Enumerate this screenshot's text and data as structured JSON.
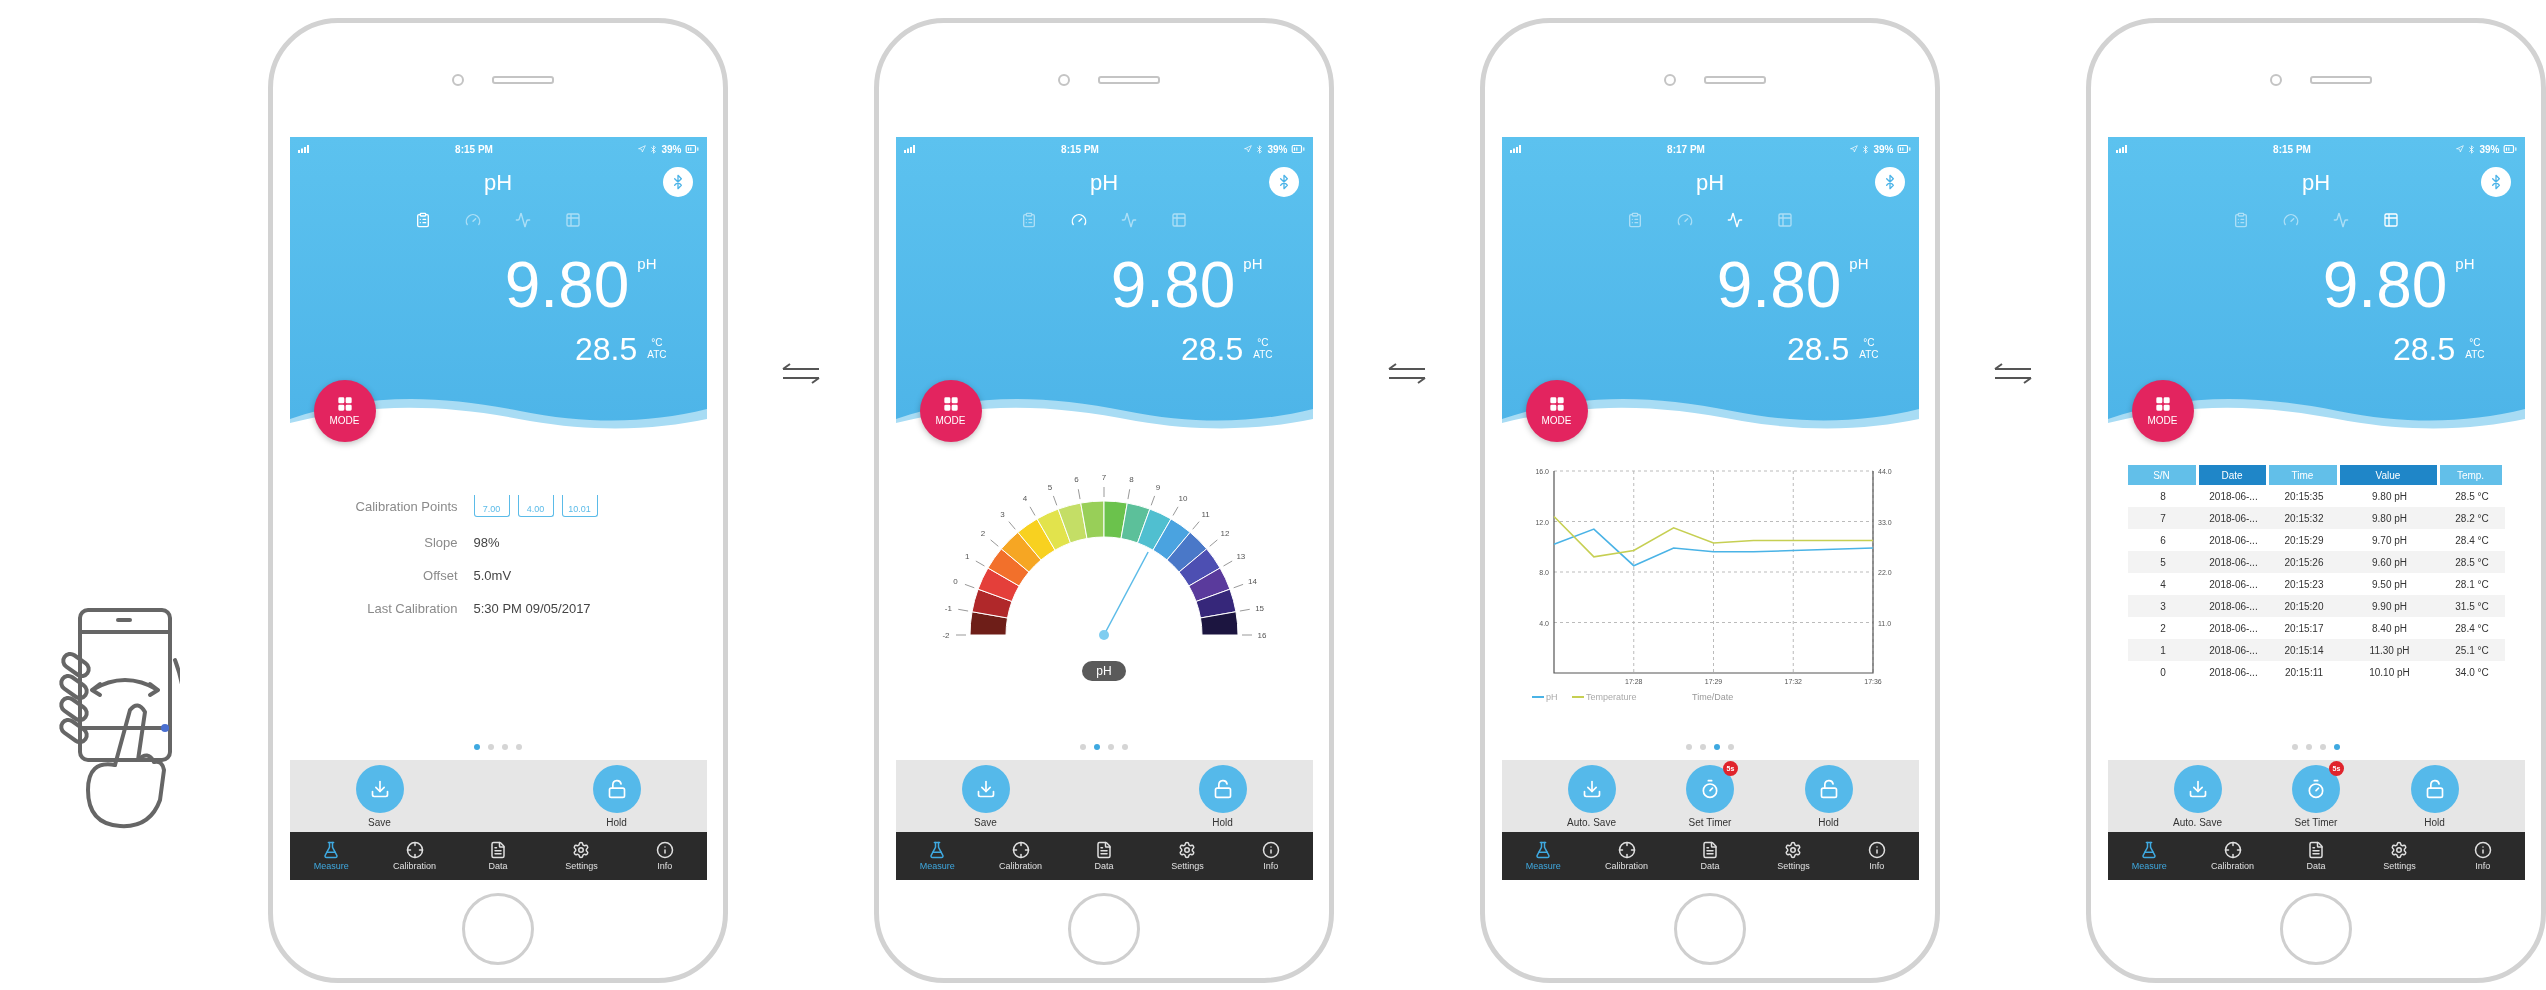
{
  "phones": [
    {
      "status_bar": {
        "time": "8:15 PM",
        "battery": "39%"
      },
      "title": "pH",
      "view_tabs": [
        {
          "selected": true
        },
        {
          "selected": false
        },
        {
          "selected": false
        },
        {
          "selected": false
        }
      ],
      "reading": {
        "value": "9.80",
        "unit": "pH"
      },
      "temperature": {
        "value": "28.5",
        "unit": "°C",
        "compensation": "ATC"
      },
      "mode_button": "MODE",
      "content": {
        "kind": "calibration",
        "calibration_points": {
          "label": "Calibration Points",
          "points": [
            "7.00",
            "4.00",
            "10.01"
          ]
        },
        "fields": [
          {
            "label": "Slope",
            "value": "98%"
          },
          {
            "label": "Offset",
            "value": "5.0mV"
          },
          {
            "label": "Last Calibration",
            "value": "5:30 PM 09/05/2017"
          }
        ]
      },
      "page_dots": [
        {
          "selected": true
        },
        {
          "selected": false
        },
        {
          "selected": false
        },
        {
          "selected": false
        }
      ],
      "actions": [
        {
          "kind": "save",
          "label": "Save"
        },
        {
          "kind": "hold",
          "label": "Hold"
        }
      ],
      "nav": [
        {
          "label": "Measure",
          "selected": true
        },
        {
          "label": "Calibration",
          "selected": false
        },
        {
          "label": "Data",
          "selected": false
        },
        {
          "label": "Settings",
          "selected": false
        },
        {
          "label": "Info",
          "selected": false
        }
      ]
    },
    {
      "status_bar": {
        "time": "8:15 PM",
        "battery": "39%"
      },
      "title": "pH",
      "view_tabs": [
        {
          "selected": false
        },
        {
          "selected": true
        },
        {
          "selected": false
        },
        {
          "selected": false
        }
      ],
      "reading": {
        "value": "9.80",
        "unit": "pH"
      },
      "temperature": {
        "value": "28.5",
        "unit": "°C",
        "compensation": "ATC"
      },
      "mode_button": "MODE",
      "content": {
        "kind": "gauge",
        "ticks": [
          "-2",
          "-1",
          "0",
          "1",
          "2",
          "3",
          "4",
          "5",
          "6",
          "7",
          "8",
          "9",
          "10",
          "11",
          "12",
          "13",
          "14",
          "15",
          "16"
        ],
        "unit": "pH"
      },
      "page_dots": [
        {
          "selected": false
        },
        {
          "selected": true
        },
        {
          "selected": false
        },
        {
          "selected": false
        }
      ],
      "actions": [
        {
          "kind": "save",
          "label": "Save"
        },
        {
          "kind": "hold",
          "label": "Hold"
        }
      ],
      "nav": [
        {
          "label": "Measure",
          "selected": true
        },
        {
          "label": "Calibration",
          "selected": false
        },
        {
          "label": "Data",
          "selected": false
        },
        {
          "label": "Settings",
          "selected": false
        },
        {
          "label": "Info",
          "selected": false
        }
      ]
    },
    {
      "status_bar": {
        "time": "8:17 PM",
        "battery": "39%"
      },
      "title": "pH",
      "view_tabs": [
        {
          "selected": false
        },
        {
          "selected": false
        },
        {
          "selected": true
        },
        {
          "selected": false
        }
      ],
      "reading": {
        "value": "9.80",
        "unit": "pH"
      },
      "temperature": {
        "value": "28.5",
        "unit": "°C",
        "compensation": "ATC"
      },
      "mode_button": "MODE",
      "content": {
        "kind": "chart",
        "chart_data": {
          "type": "line",
          "xlabel": "Time/Date",
          "categories": [
            null,
            null,
            "17:28",
            null,
            "17:29",
            null,
            "17:32",
            null,
            "17:36"
          ],
          "series": [
            {
              "name": "pH",
              "color": "#4ab3e6",
              "values": [
                10.2,
                11.4,
                8.5,
                9.9,
                9.6,
                9.6,
                9.7,
                9.8,
                9.9
              ]
            },
            {
              "name": "Temperature",
              "color": "#c6cf52",
              "values": [
                12.4,
                9.2,
                9.7,
                11.5,
                10.3,
                10.5,
                10.5,
                10.5,
                10.5
              ]
            }
          ],
          "grid": true,
          "legend": "bottom",
          "ylim": [
            0,
            16
          ],
          "yticks": [
            {
              "value": 4,
              "label": "4.0"
            },
            {
              "value": 8,
              "label": "8.0"
            },
            {
              "value": 12,
              "label": "12.0"
            },
            {
              "value": 16,
              "label": "16.0"
            }
          ]
        },
        "right_axis_ticks": [
          "44.0",
          "33.0",
          "22.0",
          "11.0"
        ]
      },
      "page_dots": [
        {
          "selected": false
        },
        {
          "selected": false
        },
        {
          "selected": true
        },
        {
          "selected": false
        }
      ],
      "actions": [
        {
          "kind": "save",
          "label": "Auto. Save"
        },
        {
          "kind": "timer",
          "label": "Set Timer",
          "badge": "5s"
        },
        {
          "kind": "hold",
          "label": "Hold"
        }
      ],
      "nav": [
        {
          "label": "Measure",
          "selected": true
        },
        {
          "label": "Calibration",
          "selected": false
        },
        {
          "label": "Data",
          "selected": false
        },
        {
          "label": "Settings",
          "selected": false
        },
        {
          "label": "Info",
          "selected": false
        }
      ]
    },
    {
      "status_bar": {
        "time": "8:15 PM",
        "battery": "39%"
      },
      "title": "pH",
      "view_tabs": [
        {
          "selected": false
        },
        {
          "selected": false
        },
        {
          "selected": false
        },
        {
          "selected": true
        }
      ],
      "reading": {
        "value": "9.80",
        "unit": "pH"
      },
      "temperature": {
        "value": "28.5",
        "unit": "°C",
        "compensation": "ATC"
      },
      "mode_button": "MODE",
      "content": {
        "kind": "table",
        "columns": [
          "S/N",
          "Date",
          "Time",
          "Value",
          "Temp."
        ],
        "rows": [
          [
            "8",
            "2018-06-...",
            "20:15:35",
            "9.80 pH",
            "28.5 °C"
          ],
          [
            "7",
            "2018-06-...",
            "20:15:32",
            "9.80 pH",
            "28.2 °C"
          ],
          [
            "6",
            "2018-06-...",
            "20:15:29",
            "9.70 pH",
            "28.4 °C"
          ],
          [
            "5",
            "2018-06-...",
            "20:15:26",
            "9.60 pH",
            "28.5 °C"
          ],
          [
            "4",
            "2018-06-...",
            "20:15:23",
            "9.50 pH",
            "28.1 °C"
          ],
          [
            "3",
            "2018-06-...",
            "20:15:20",
            "9.90 pH",
            "31.5 °C"
          ],
          [
            "2",
            "2018-06-...",
            "20:15:17",
            "8.40 pH",
            "28.4 °C"
          ],
          [
            "1",
            "2018-06-...",
            "20:15:14",
            "11.30 pH",
            "25.1 °C"
          ],
          [
            "0",
            "2018-06-...",
            "20:15:11",
            "10.10 pH",
            "34.0 °C"
          ]
        ]
      },
      "page_dots": [
        {
          "selected": false
        },
        {
          "selected": false
        },
        {
          "selected": false
        },
        {
          "selected": true
        }
      ],
      "actions": [
        {
          "kind": "save",
          "label": "Auto. Save"
        },
        {
          "kind": "timer",
          "label": "Set Timer",
          "badge": "5s"
        },
        {
          "kind": "hold",
          "label": "Hold"
        }
      ],
      "nav": [
        {
          "label": "Measure",
          "selected": true
        },
        {
          "label": "Calibration",
          "selected": false
        },
        {
          "label": "Data",
          "selected": false
        },
        {
          "label": "Settings",
          "selected": false
        },
        {
          "label": "Info",
          "selected": false
        }
      ]
    }
  ]
}
